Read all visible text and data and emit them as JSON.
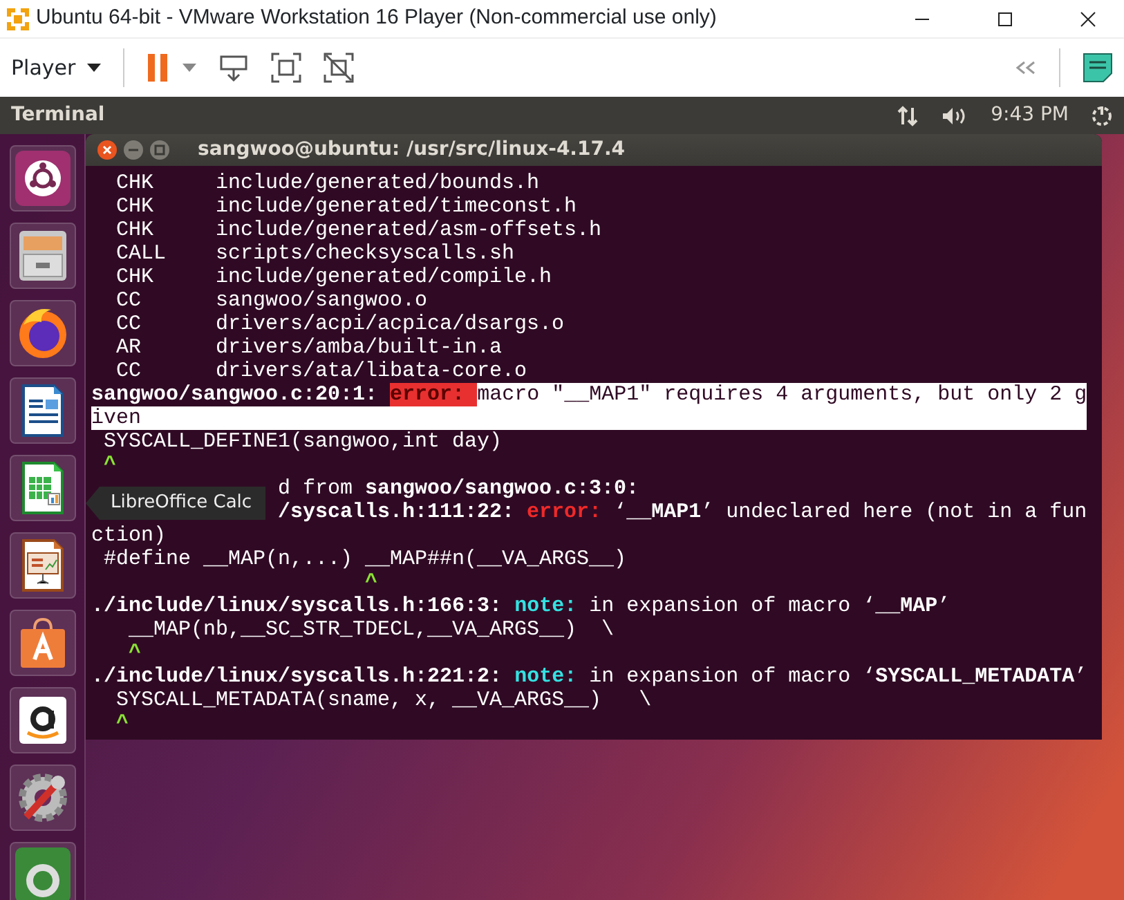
{
  "window": {
    "title": "Ubuntu 64-bit - VMware Workstation 16 Player (Non-commercial use only)"
  },
  "toolbar": {
    "menu": "Player"
  },
  "topbar": {
    "app": "Terminal",
    "clock": "9:43 PM"
  },
  "launcher": [
    {
      "kind": "dash"
    },
    {
      "kind": "files"
    },
    {
      "kind": "browser"
    },
    {
      "kind": "writer"
    },
    {
      "kind": "calc"
    },
    {
      "kind": "impress"
    },
    {
      "kind": "software"
    },
    {
      "kind": "amazon"
    },
    {
      "kind": "settings"
    },
    {
      "kind": "updater"
    }
  ],
  "tooltip": "LibreOffice Calc",
  "terminal": {
    "title": "sangwoo@ubuntu: /usr/src/linux-4.17.4",
    "lines": [
      {
        "kind": "normal",
        "segments": [
          {
            "text": "  CHK     include/generated/bounds.h",
            "kind": "plain",
            "selected": false
          }
        ]
      },
      {
        "kind": "normal",
        "segments": [
          {
            "text": "  CHK     include/generated/timeconst.h",
            "kind": "plain",
            "selected": false
          }
        ]
      },
      {
        "kind": "normal",
        "segments": [
          {
            "text": "  CHK     include/generated/asm-offsets.h",
            "kind": "plain",
            "selected": false
          }
        ]
      },
      {
        "kind": "normal",
        "segments": [
          {
            "text": "  CALL    scripts/checksyscalls.sh",
            "kind": "plain",
            "selected": false
          }
        ]
      },
      {
        "kind": "normal",
        "segments": [
          {
            "text": "  CHK     include/generated/compile.h",
            "kind": "plain",
            "selected": false
          }
        ]
      },
      {
        "kind": "normal",
        "segments": [
          {
            "text": "  CC      sangwoo/sangwoo.o",
            "kind": "plain",
            "selected": false
          }
        ]
      },
      {
        "kind": "normal",
        "segments": [
          {
            "text": "  CC      drivers/acpi/acpica/dsargs.o",
            "kind": "plain",
            "selected": false
          }
        ]
      },
      {
        "kind": "normal",
        "segments": [
          {
            "text": "  AR      drivers/amba/built-in.a",
            "kind": "plain",
            "selected": false
          }
        ]
      },
      {
        "kind": "normal",
        "segments": [
          {
            "text": "  CC      drivers/ata/libata-core.o",
            "kind": "plain",
            "selected": false
          }
        ]
      },
      {
        "kind": "normal",
        "segments": [
          {
            "text": "sangwoo/sangwoo.c:20:1: ",
            "kind": "bold",
            "selected": false
          },
          {
            "text": "error: ",
            "kind": "error",
            "selected": true
          },
          {
            "text": "macro \"__MAP1\" requires 4 arguments, but only 2 g",
            "kind": "plain",
            "selected": true
          }
        ]
      },
      {
        "kind": "normal",
        "segments": [
          {
            "text": "iven",
            "kind": "plain",
            "selected": true
          }
        ]
      },
      {
        "kind": "normal",
        "segments": [
          {
            "text": " SYSCALL_DEFINE1(sangwoo,int day)",
            "kind": "plain",
            "selected": false
          }
        ]
      },
      {
        "kind": "normal",
        "segments": [
          {
            "text": " ^",
            "kind": "caret",
            "selected": false
          }
        ]
      },
      {
        "kind": "covered",
        "segments": [
          {
            "text": "d from ",
            "kind": "plain",
            "selected": false
          },
          {
            "text": "sangwoo/sangwoo.c:3:0:",
            "kind": "bold",
            "selected": false
          }
        ]
      },
      {
        "kind": "covered",
        "segments": [
          {
            "text": "/syscalls.h:111:22: ",
            "kind": "bold",
            "selected": false
          },
          {
            "text": "error:",
            "kind": "error",
            "selected": false
          },
          {
            "text": " ‘",
            "kind": "plain",
            "selected": false
          },
          {
            "text": "__MAP1",
            "kind": "bold",
            "selected": false
          },
          {
            "text": "’ undeclared here (not in a fun",
            "kind": "plain",
            "selected": false
          }
        ]
      },
      {
        "kind": "normal",
        "segments": [
          {
            "text": "ction)",
            "kind": "plain",
            "selected": false
          }
        ]
      },
      {
        "kind": "normal",
        "segments": [
          {
            "text": " #define __MAP(n,...) __MAP##n(__VA_ARGS__)",
            "kind": "plain",
            "selected": false
          }
        ]
      },
      {
        "kind": "normal",
        "segments": [
          {
            "text": "                      ^",
            "kind": "caret",
            "selected": false
          }
        ]
      },
      {
        "kind": "normal",
        "segments": [
          {
            "text": "./include/linux/syscalls.h:166:3: ",
            "kind": "bold",
            "selected": false
          },
          {
            "text": "note:",
            "kind": "note",
            "selected": false
          },
          {
            "text": " in expansion of macro ‘",
            "kind": "plain",
            "selected": false
          },
          {
            "text": "__MAP",
            "kind": "bold",
            "selected": false
          },
          {
            "text": "’",
            "kind": "plain",
            "selected": false
          }
        ]
      },
      {
        "kind": "normal",
        "segments": [
          {
            "text": "   __MAP(nb,__SC_STR_TDECL,__VA_ARGS__)  \\",
            "kind": "plain",
            "selected": false
          }
        ]
      },
      {
        "kind": "normal",
        "segments": [
          {
            "text": "   ^",
            "kind": "caret",
            "selected": false
          }
        ]
      },
      {
        "kind": "normal",
        "segments": [
          {
            "text": "./include/linux/syscalls.h:221:2: ",
            "kind": "bold",
            "selected": false
          },
          {
            "text": "note:",
            "kind": "note",
            "selected": false
          },
          {
            "text": " in expansion of macro ‘",
            "kind": "plain",
            "selected": false
          },
          {
            "text": "SYSCALL_METADATA",
            "kind": "bold",
            "selected": false
          },
          {
            "text": "’",
            "kind": "plain",
            "selected": false
          }
        ]
      },
      {
        "kind": "normal",
        "segments": [
          {
            "text": "  SYSCALL_METADATA(sname, x, __VA_ARGS__)   \\",
            "kind": "plain",
            "selected": false
          }
        ]
      },
      {
        "kind": "normal",
        "segments": [
          {
            "text": "  ^",
            "kind": "caret",
            "selected": false
          }
        ]
      }
    ]
  }
}
